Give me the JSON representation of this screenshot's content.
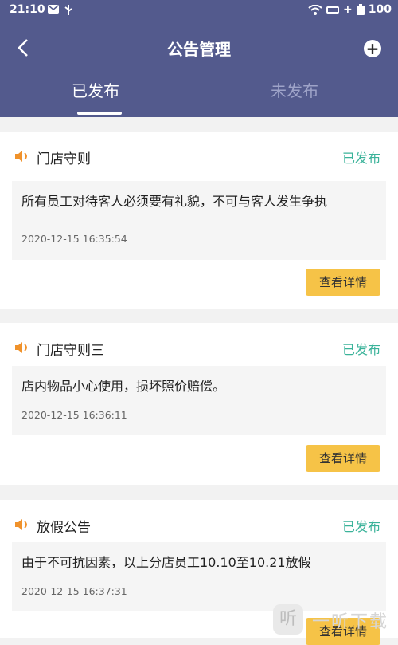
{
  "status_bar": {
    "time": "21:10",
    "battery": "100"
  },
  "header": {
    "title": "公告管理"
  },
  "tabs": [
    {
      "label": "已发布",
      "active": true
    },
    {
      "label": "未发布",
      "active": false
    }
  ],
  "notices": [
    {
      "title": "门店守则",
      "status": "已发布",
      "content": "所有员工对待客人必须要有礼貌，不可与客人发生争执",
      "time": "2020-12-15 16:35:54",
      "button": "查看详情"
    },
    {
      "title": "门店守则三",
      "status": "已发布",
      "content": "店内物品小心使用，损坏照价赔偿。",
      "time": "2020-12-15 16:36:11",
      "button": "查看详情"
    },
    {
      "title": "放假公告",
      "status": "已发布",
      "content": "由于不可抗因素，以上分店员工10.10至10.21放假",
      "time": "2020-12-15 16:37:31",
      "button": "查看详情"
    }
  ],
  "watermark": {
    "icon_text": "听",
    "text": "一听下载"
  },
  "colors": {
    "header": "#535a8d",
    "status_published": "#3bb39a",
    "button": "#f6c347",
    "speaker": "#f0922b"
  }
}
